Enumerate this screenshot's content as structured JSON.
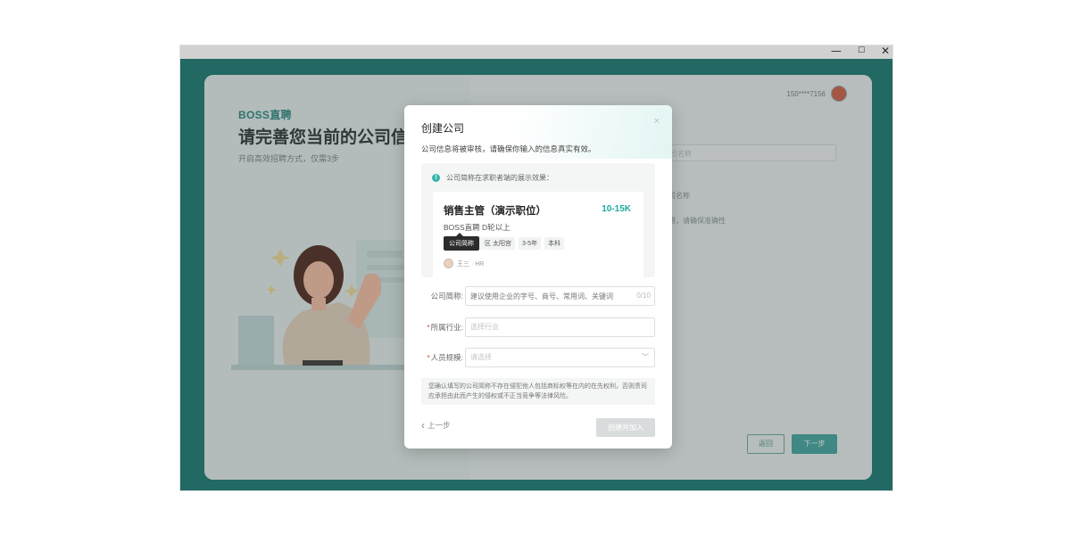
{
  "window": {
    "minimize_glyph": "—",
    "maximize_glyph": "☐",
    "close_glyph": "✕"
  },
  "background": {
    "brand": "BOSS直聘",
    "title": "请完善您当前的公司信息",
    "subtitle": "开启高效招聘方式，仅需3步",
    "user_phone": "150****7156",
    "right_text_1": "司名称",
    "right_text_2": "用，请确保准确性",
    "input_placeholder": "司名称",
    "back_button": "返回",
    "next_button": "下一步"
  },
  "modal": {
    "title": "创建公司",
    "close_glyph": "×",
    "notice": "公司信息将被审核，请确保你输入的信息真实有效。",
    "preview": {
      "info_glyph": "!",
      "label": "公司简称在求职者端的展示效果：",
      "job_title": "销售主管（演示职位）",
      "salary": "10-15K",
      "company_line": "BOSS直聘   D轮以上",
      "tooltip": "公司简称",
      "tags": [
        "区 太阳宫",
        "3-5年",
        "本科"
      ],
      "recruiter": "王三 · HR"
    },
    "form": {
      "short_name": {
        "label": "公司简称:",
        "placeholder": "建议使用企业的字号、商号、常用词、关键词",
        "counter": "0/10"
      },
      "industry": {
        "required_mark": "*",
        "label": "所属行业:",
        "placeholder": "选择行业"
      },
      "size": {
        "required_mark": "*",
        "label": "人员规模:",
        "placeholder": "请选择",
        "chevron": "﹀"
      }
    },
    "disclaimer": "您确认填写的公司简称不存在侵犯他人包括商标权等在内的在先权利，否则责司应承担由此而产生的侵权或不正当竞争等法律风险。",
    "prev_step": "上一步",
    "prev_glyph": "‹",
    "create_button": "创建并加入"
  },
  "colors": {
    "accent": "#1eaaa0",
    "app_background": "#2a7f79",
    "required": "#e0463c",
    "disabled_button": "#d9dcdd"
  }
}
